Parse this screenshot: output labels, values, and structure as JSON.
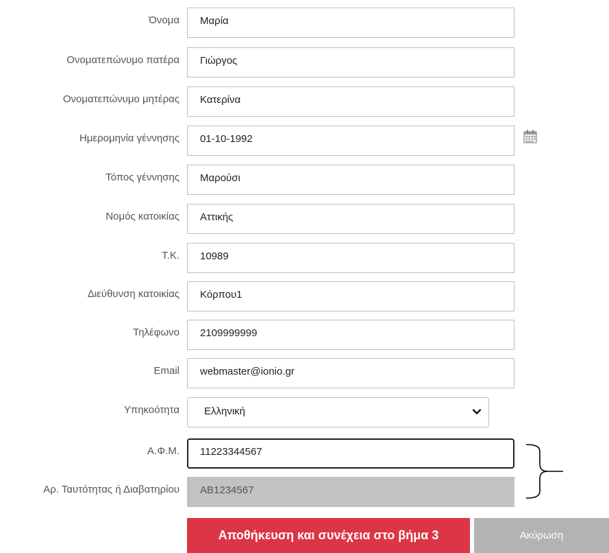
{
  "form": {
    "fields": [
      {
        "label": "Όνομα",
        "value": "Μαρία"
      },
      {
        "label": "Ονοματεπώνυμο πατέρα",
        "value": "Γιώργος"
      },
      {
        "label": "Ονοματεπώνυμο μητέρας",
        "value": "Κατερίνα"
      },
      {
        "label": "Ημερομηνία γέννησης",
        "value": "01-10-1992"
      },
      {
        "label": "Τόπος γέννησης",
        "value": "Μαρούσι"
      },
      {
        "label": "Νομός κατοικίας",
        "value": "Αττικής"
      },
      {
        "label": "Τ.Κ.",
        "value": "10989"
      },
      {
        "label": "Διεύθυνση κατοικίας",
        "value": "Κόρπου1"
      },
      {
        "label": "Τηλέφωνο",
        "value": "2109999999"
      },
      {
        "label": "Email",
        "value": "webmaster@ionio.gr"
      }
    ],
    "citizenship": {
      "label": "Υπηκοότητα",
      "selected": "Ελληνική"
    },
    "afm": {
      "label": "Α.Φ.Μ.",
      "value": "11223344567"
    },
    "id_number": {
      "label": "Αρ. Ταυτότητας ή Διαβατηρίου",
      "value": "AB1234567"
    }
  },
  "buttons": {
    "save": "Αποθήκευση και συνέχεια στο βήμα 3",
    "cancel": "Ακύρωση"
  },
  "icons": {
    "calendar": "calendar-icon",
    "select_chevron": "chevron-down-icon"
  },
  "colors": {
    "save_button": "#dc3545",
    "cancel_button": "#b3b3b3",
    "disabled_field": "#c2c2c2",
    "label_text": "#555555"
  }
}
